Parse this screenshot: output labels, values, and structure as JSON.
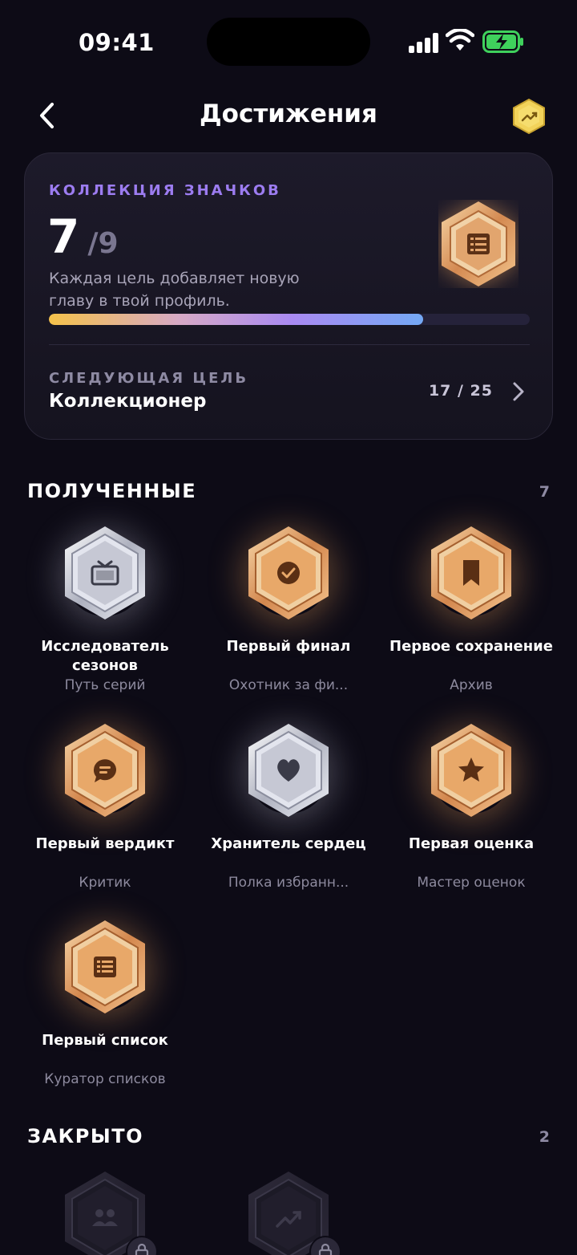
{
  "status_bar": {
    "time": "09:41"
  },
  "header": {
    "title": "Достижения",
    "back_icon": "chevron-left-icon",
    "trend_icon": "trending-up-icon"
  },
  "summary": {
    "kicker": "КОЛЛЕКЦИЯ ЗНАЧКОВ",
    "earned": "7",
    "separator": "/",
    "total": "9",
    "description": "Каждая цель добавляет новую главу в твой профиль.",
    "progress_fraction": 0.778,
    "hero_icon": "list-icon",
    "next_kicker": "СЛЕДУЮЩАЯ ЦЕЛЬ",
    "next_name": "Коллекционер",
    "next_progress": "17 / 25"
  },
  "earned_section": {
    "title": "ПОЛУЧЕННЫЕ",
    "count": "7",
    "badges": [
      {
        "name": "Исследователь сезонов",
        "subtitle": "Путь серий",
        "tier": "silver",
        "icon": "tv-icon"
      },
      {
        "name": "Первый финал",
        "subtitle": "Охотник за фи...",
        "tier": "gold",
        "icon": "check-circle-icon"
      },
      {
        "name": "Первое сохранение",
        "subtitle": "Архив",
        "tier": "gold",
        "icon": "bookmark-icon"
      },
      {
        "name": "Первый вердикт",
        "subtitle": "Критик",
        "tier": "gold",
        "icon": "chat-bubble-icon"
      },
      {
        "name": "Хранитель сердец",
        "subtitle": "Полка избранн...",
        "tier": "silver",
        "icon": "heart-icon"
      },
      {
        "name": "Первая оценка",
        "subtitle": "Мастер оценок",
        "tier": "gold",
        "icon": "star-icon"
      },
      {
        "name": "Первый список",
        "subtitle": "Куратор списков",
        "tier": "gold",
        "icon": "list-icon"
      }
    ]
  },
  "locked_section": {
    "title": "ЗАКРЫТО",
    "count": "2",
    "badges": [
      {
        "tier": "locked",
        "icon": "users-icon"
      },
      {
        "tier": "locked",
        "icon": "trending-up-icon"
      }
    ]
  },
  "colors": {
    "background": "#0d0b16",
    "accent": "#9c7cf0",
    "gold": "#e9a562",
    "silver": "#c9cbd6"
  }
}
